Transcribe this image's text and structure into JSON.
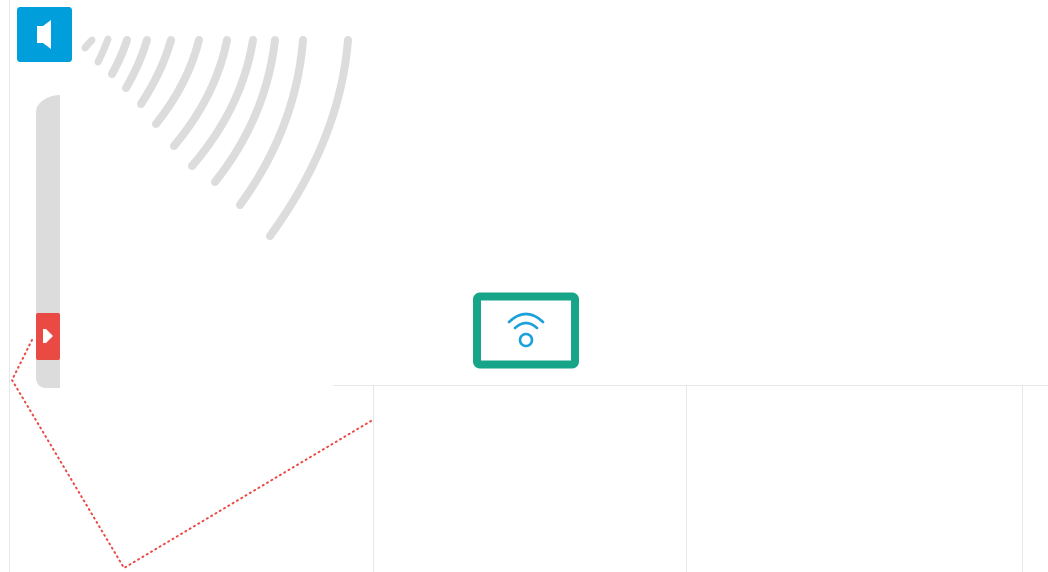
{
  "colors": {
    "background": "#ffffff",
    "speaker_tile": "#009fdb",
    "speaker_glyph": "#ffffff",
    "sound_waves": "#dcdcdc",
    "track": "#dcdcdc",
    "marker": "#ea4a44",
    "path_dots": "#ea4a44",
    "panel_border": "#17a589",
    "wifi": "#1ba0da",
    "grid_lines": "#e6e6e6"
  },
  "icons": {
    "speaker": "speaker-icon",
    "waves": "sound-waves-icon",
    "marker": "play-marker-icon",
    "wifi": "wifi-icon"
  }
}
